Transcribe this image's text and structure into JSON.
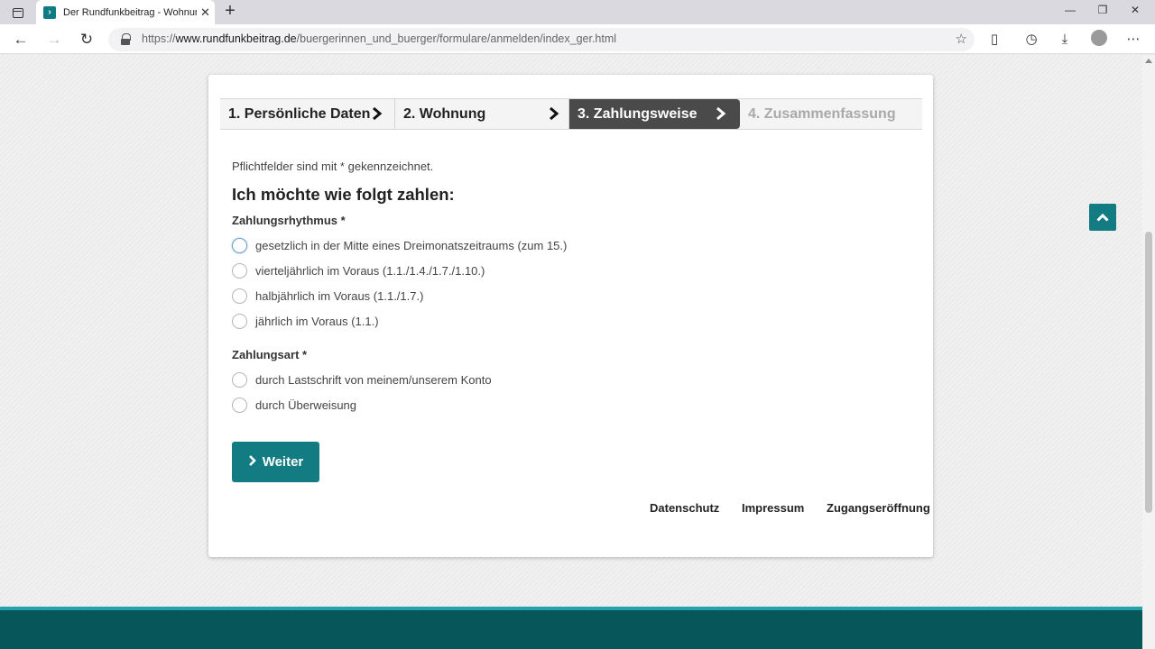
{
  "browser": {
    "tab_title": "Der Rundfunkbeitrag - Wohnung",
    "url_scheme": "https://",
    "url_domain": "www.rundfunkbeitrag.de",
    "url_path": "/buergerinnen_und_buerger/formulare/anmelden/index_ger.html",
    "new_tab": "+",
    "tab_close": "✕"
  },
  "stepper": {
    "steps": [
      {
        "label": "1. Persönliche Daten",
        "state": "done"
      },
      {
        "label": "2. Wohnung",
        "state": "done"
      },
      {
        "label": "3. Zahlungsweise",
        "state": "active"
      },
      {
        "label": "4. Zusammenfassung",
        "state": "upcoming"
      }
    ]
  },
  "form": {
    "required_note": "Pflichtfelder sind mit * gekennzeichnet.",
    "heading": "Ich möchte wie folgt zahlen:",
    "rhythm_label": "Zahlungsrhythmus *",
    "rhythm_options": [
      "gesetzlich in der Mitte eines Dreimonatszeitraums (zum 15.)",
      "vierteljährlich im Voraus (1.1./1.4./1.7./1.10.)",
      "halbjährlich im Voraus (1.1./1.7.)",
      "jährlich im Voraus (1.1.)"
    ],
    "type_label": "Zahlungsart *",
    "type_options": [
      "durch Lastschrift von meinem/unserem Konto",
      "durch Überweisung"
    ],
    "next_button": "Weiter"
  },
  "footer_links": [
    "Datenschutz",
    "Impressum",
    "Zugangseröffnung"
  ],
  "colors": {
    "brand_teal": "#137b82",
    "footer_dark": "#06565a",
    "footer_accent": "#26a0ab",
    "active_step": "#4a4a4a"
  }
}
